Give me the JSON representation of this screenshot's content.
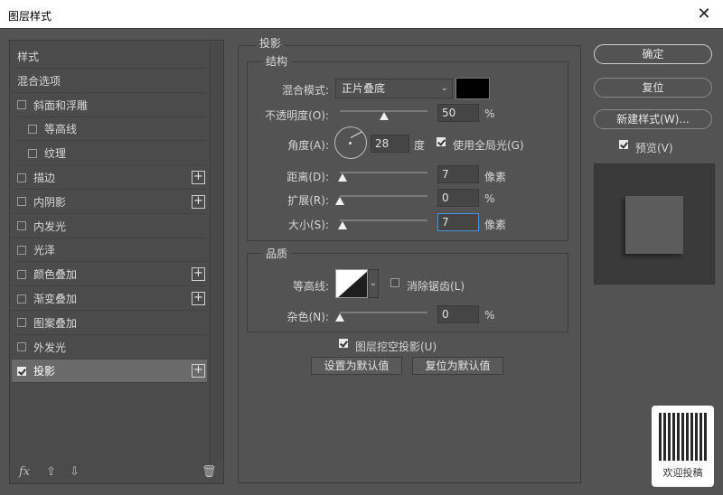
{
  "window": {
    "title": "图层样式",
    "close_icon": "close-icon"
  },
  "left_panel": {
    "items": [
      {
        "label": "样式",
        "checkbox": false,
        "checked": false,
        "plus": false,
        "indent": false,
        "selected": false
      },
      {
        "label": "混合选项",
        "checkbox": false,
        "checked": false,
        "plus": false,
        "indent": false,
        "selected": false
      },
      {
        "label": "斜面和浮雕",
        "checkbox": true,
        "checked": false,
        "plus": false,
        "indent": false,
        "selected": false
      },
      {
        "label": "等高线",
        "checkbox": true,
        "checked": false,
        "plus": false,
        "indent": true,
        "selected": false
      },
      {
        "label": "纹理",
        "checkbox": true,
        "checked": false,
        "plus": false,
        "indent": true,
        "selected": false
      },
      {
        "label": "描边",
        "checkbox": true,
        "checked": false,
        "plus": true,
        "indent": false,
        "selected": false
      },
      {
        "label": "内阴影",
        "checkbox": true,
        "checked": false,
        "plus": true,
        "indent": false,
        "selected": false
      },
      {
        "label": "内发光",
        "checkbox": true,
        "checked": false,
        "plus": false,
        "indent": false,
        "selected": false
      },
      {
        "label": "光泽",
        "checkbox": true,
        "checked": false,
        "plus": false,
        "indent": false,
        "selected": false
      },
      {
        "label": "颜色叠加",
        "checkbox": true,
        "checked": false,
        "plus": true,
        "indent": false,
        "selected": false
      },
      {
        "label": "渐变叠加",
        "checkbox": true,
        "checked": false,
        "plus": true,
        "indent": false,
        "selected": false
      },
      {
        "label": "图案叠加",
        "checkbox": true,
        "checked": false,
        "plus": false,
        "indent": false,
        "selected": false
      },
      {
        "label": "外发光",
        "checkbox": true,
        "checked": false,
        "plus": false,
        "indent": false,
        "selected": false
      },
      {
        "label": "投影",
        "checkbox": true,
        "checked": true,
        "plus": true,
        "indent": false,
        "selected": true
      }
    ],
    "bottom": {
      "fx": "fx",
      "fx_icon": "fx-icon",
      "up_icon": "arrow-up-icon",
      "down_icon": "arrow-down-icon",
      "trash_icon": "trash-icon"
    }
  },
  "main": {
    "section_title": "投影",
    "structure": {
      "title": "结构",
      "blend_mode_label": "混合模式:",
      "blend_mode_value": "正片叠底",
      "color": "#000000",
      "opacity_label": "不透明度(O):",
      "opacity_value": "50",
      "opacity_unit": "%",
      "opacity_level": 0.5,
      "angle_label": "角度(A):",
      "angle_value": "28",
      "angle_unit": "度",
      "global_light_label": "使用全局光(G)",
      "global_light_checked": true,
      "distance_label": "距离(D):",
      "distance_value": "7",
      "distance_unit": "像素",
      "distance_level": 0.03,
      "spread_label": "扩展(R):",
      "spread_value": "0",
      "spread_unit": "%",
      "spread_level": 0.0,
      "size_label": "大小(S):",
      "size_value": "7",
      "size_unit": "像素",
      "size_level": 0.03
    },
    "quality": {
      "title": "品质",
      "contour_label": "等高线:",
      "antialias_label": "消除锯齿(L)",
      "antialias_checked": false,
      "noise_label": "杂色(N):",
      "noise_value": "0",
      "noise_unit": "%",
      "noise_level": 0.0
    },
    "knockout_label": "图层挖空投影(U)",
    "knockout_checked": true,
    "set_default_label": "设置为默认值",
    "reset_default_label": "复位为默认值"
  },
  "right": {
    "ok_label": "确定",
    "reset_label": "复位",
    "new_style_label": "新建样式(W)...",
    "preview_label": "预览(V)",
    "preview_checked": true
  },
  "qr": {
    "caption": "欢迎投稿"
  }
}
